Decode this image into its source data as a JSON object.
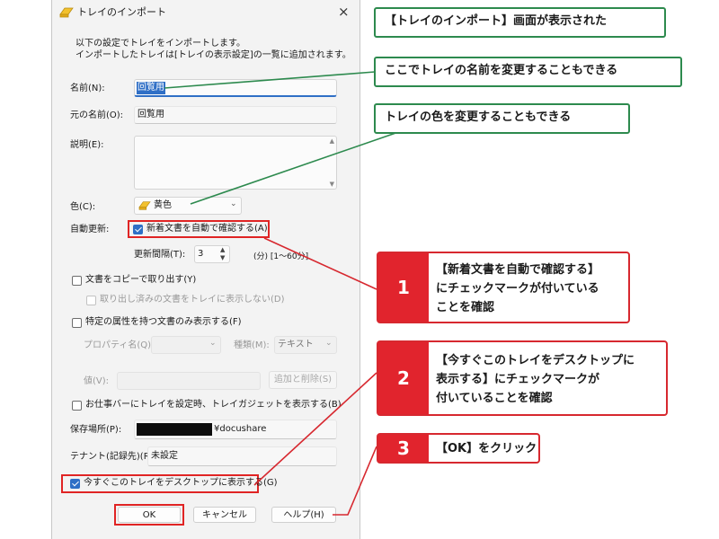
{
  "window": {
    "title": "トレイのインポート",
    "close_glyph": "×"
  },
  "intro": {
    "line1": "以下の設定でトレイをインポートします。",
    "line2": "インポートしたトレイは[トレイの表示設定]の一覧に追加されます。"
  },
  "name": {
    "label": "名前(N):",
    "value": "回覧用"
  },
  "original_name": {
    "label": "元の名前(O):",
    "value": "回覧用"
  },
  "description": {
    "label": "説明(E):",
    "value": ""
  },
  "color": {
    "label": "色(C):",
    "value": "黄色",
    "swatch": "#f2c12e"
  },
  "auto_update": {
    "label": "自動更新:",
    "checkbox_label": "新着文書を自動で確認する(A)",
    "checked": true,
    "interval_label": "更新間隔(T):",
    "interval_value": "3",
    "interval_unit": "(分) [1～60分]"
  },
  "copy_out": {
    "label": "文書をコピーで取り出す(Y)",
    "sub_label": "取り出し済みの文書をトレイに表示しない(D)"
  },
  "attr_filter": {
    "label": "特定の属性を持つ文書のみ表示する(F)",
    "property_label": "プロパティ名(Q):",
    "type_label": "種類(M):",
    "type_value": "テキスト",
    "value_label": "値(V):",
    "add_delete_button": "追加と削除(S)"
  },
  "gadget": {
    "label": "お仕事バーにトレイを設定時、トレイガジェットを表示する(B)"
  },
  "save_location": {
    "label": "保存場所(P):",
    "value": "¥docushare"
  },
  "tenant": {
    "label": "テナント(記録先)(R):",
    "value": "未設定"
  },
  "desktop": {
    "label": "今すぐこのトレイをデスクトップに表示する(G)",
    "checked": true
  },
  "buttons": {
    "ok": "OK",
    "cancel": "キャンセル",
    "help": "ヘルプ(H)"
  },
  "callouts": {
    "c1": "【トレイのインポート】画面が表示された",
    "c2": "ここでトレイの名前を変更することもできる",
    "c3": "トレイの色を変更することもできる",
    "step1": {
      "num": "1",
      "line1": "【新着文書を自動で確認する】",
      "line2": "にチェックマークが付いている",
      "line3": "ことを確認"
    },
    "step2": {
      "num": "2",
      "line1": "【今すぐこのトレイをデスクトップに",
      "line2": "表示する】にチェックマークが",
      "line3": "付いていることを確認"
    },
    "step3": {
      "num": "3",
      "line1": "【OK】をクリック"
    }
  },
  "colors": {
    "green": "#2d8a4e",
    "red": "#e1242d",
    "accent": "#2f6fc6"
  }
}
